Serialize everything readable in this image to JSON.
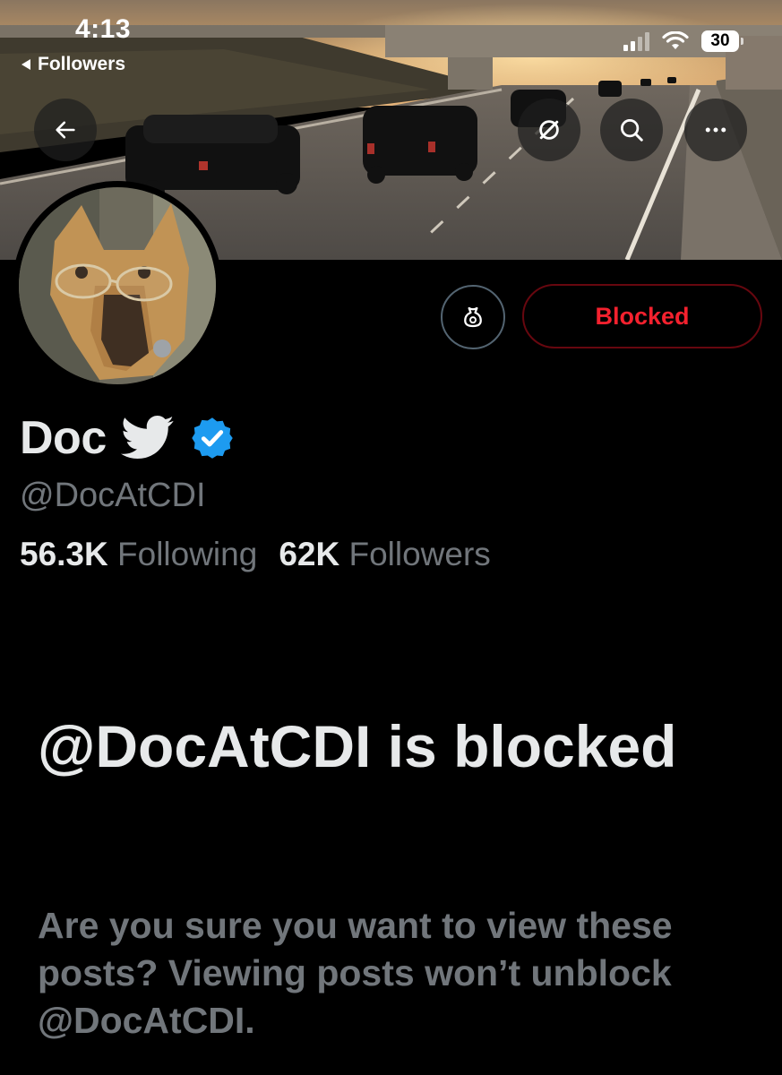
{
  "status_bar": {
    "time": "4:13",
    "back_label": "Followers",
    "battery": "30"
  },
  "banner": {
    "back_icon": "arrow-left-icon",
    "grok_icon": "grok-icon",
    "search_icon": "search-icon",
    "more_icon": "more-horizontal-icon"
  },
  "profile": {
    "name": "Doc",
    "handle": "@DocAtCDI",
    "verified": true,
    "following_count": "56.3K",
    "following_label": "Following",
    "followers_count": "62K",
    "followers_label": "Followers"
  },
  "actions": {
    "notifications_icon": "bell-icon",
    "blocked_label": "Blocked"
  },
  "blocked_notice": {
    "title": "@DocAtCDI is blocked",
    "description": "Are you sure you want to view these posts? Viewing posts won’t unblock @DocAtCDI."
  },
  "colors": {
    "background": "#000000",
    "blocked_red": "#f4212e",
    "blocked_border": "#67070f",
    "muted_text": "#71767b",
    "verified_blue": "#1d9bf0"
  }
}
